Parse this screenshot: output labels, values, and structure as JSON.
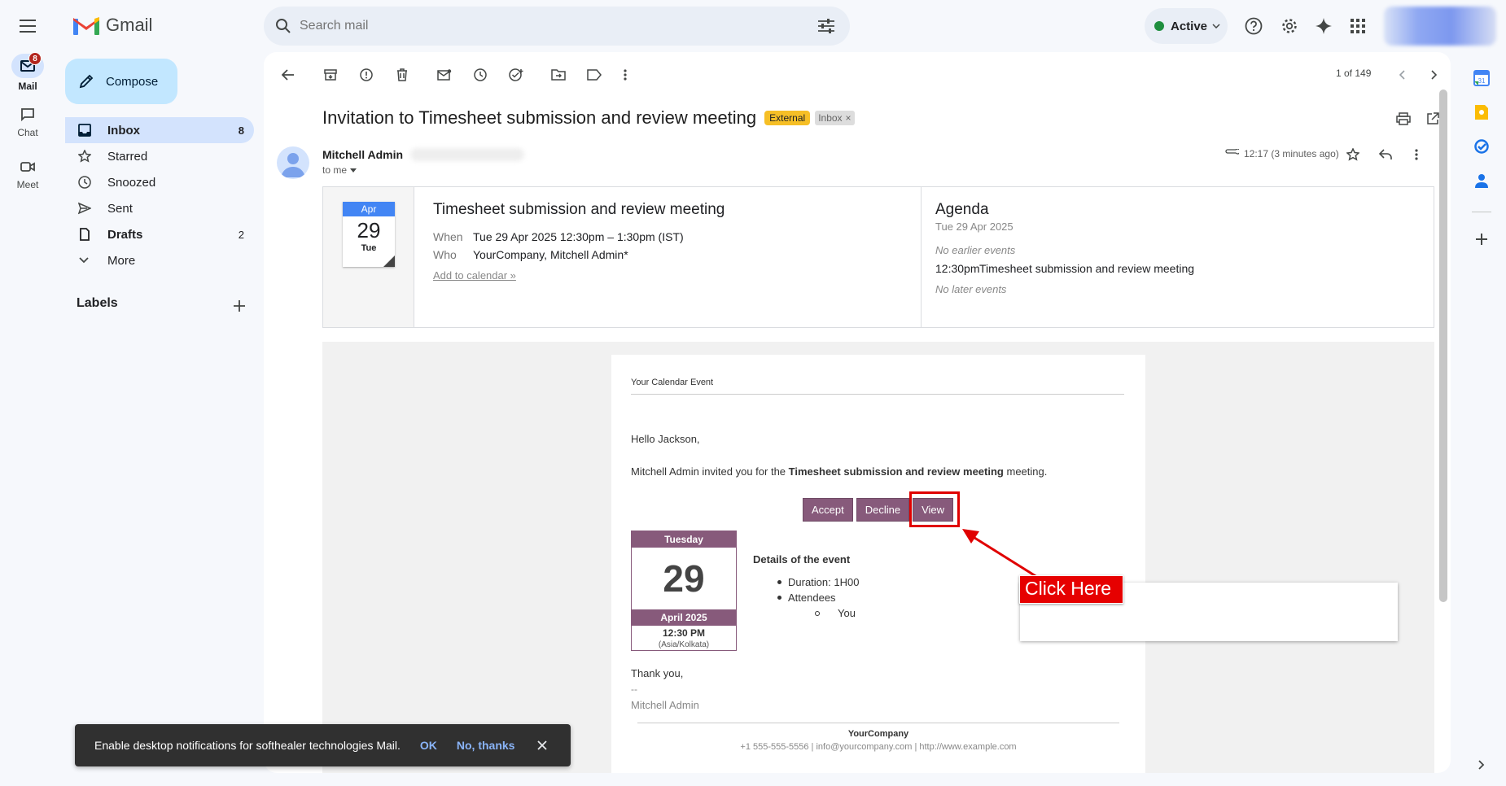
{
  "app": {
    "name": "Gmail"
  },
  "rail": {
    "mail_label": "Mail",
    "mail_badge": "8",
    "chat_label": "Chat",
    "meet_label": "Meet"
  },
  "search": {
    "placeholder": "Search mail"
  },
  "header": {
    "status": "Active"
  },
  "compose": {
    "label": "Compose"
  },
  "sidebar": {
    "items": [
      {
        "label": "Inbox",
        "count": "8"
      },
      {
        "label": "Starred",
        "count": ""
      },
      {
        "label": "Snoozed",
        "count": ""
      },
      {
        "label": "Sent",
        "count": ""
      },
      {
        "label": "Drafts",
        "count": "2"
      },
      {
        "label": "More",
        "count": ""
      }
    ],
    "labels_title": "Labels"
  },
  "toolbar": {
    "pagination": "1 of 149"
  },
  "email": {
    "subject": "Invitation to Timesheet submission and review meeting",
    "tag_external": "External",
    "tag_inbox": "Inbox",
    "tag_close": "×",
    "sender": "Mitchell Admin",
    "to": "to me",
    "time": "12:17 (3 minutes ago)"
  },
  "invite_card": {
    "month": "Apr",
    "day": "29",
    "weekday": "Tue",
    "title": "Timesheet submission and review meeting",
    "when_label": "When",
    "when_value": "Tue 29 Apr 2025 12:30pm – 1:30pm (IST)",
    "who_label": "Who",
    "who_value": "YourCompany, Mitchell Admin*",
    "add_link": "Add to calendar »"
  },
  "agenda": {
    "title": "Agenda",
    "date": "Tue 29 Apr 2025",
    "no_earlier": "No earlier events",
    "event_time": "12:30pm",
    "event_title": "Timesheet submission and review meeting",
    "no_later": "No later events"
  },
  "body": {
    "header": "Your Calendar Event",
    "greeting": "Hello Jackson,",
    "invite_pre": "Mitchell Admin invited you for the",
    "invite_bold": "Timesheet submission and review meeting",
    "invite_post": "meeting.",
    "accept": "Accept",
    "decline": "Decline",
    "view": "View",
    "cal_weekday": "Tuesday",
    "cal_day": "29",
    "cal_month": "April 2025",
    "cal_time": "12:30 PM",
    "cal_tz": "(Asia/Kolkata)",
    "details_title": "Details of the event",
    "duration": "Duration: 1H00",
    "attendees": "Attendees",
    "attendee_1": "You",
    "thanks": "Thank you,",
    "sig_sep": "--",
    "signature": "Mitchell Admin",
    "footer_company": "YourCompany",
    "footer_contact": "+1 555-555-5556 | info@yourcompany.com | http://www.example.com"
  },
  "annotation": {
    "label": "Click Here"
  },
  "notification": {
    "text": "Enable desktop notifications for softhealer technologies Mail.",
    "ok": "OK",
    "no": "No, thanks"
  },
  "colors": {
    "accent": "#0b57d0",
    "odoo": "#875a7b",
    "annotation": "#e00000",
    "tag_external": "#f6bf26"
  }
}
